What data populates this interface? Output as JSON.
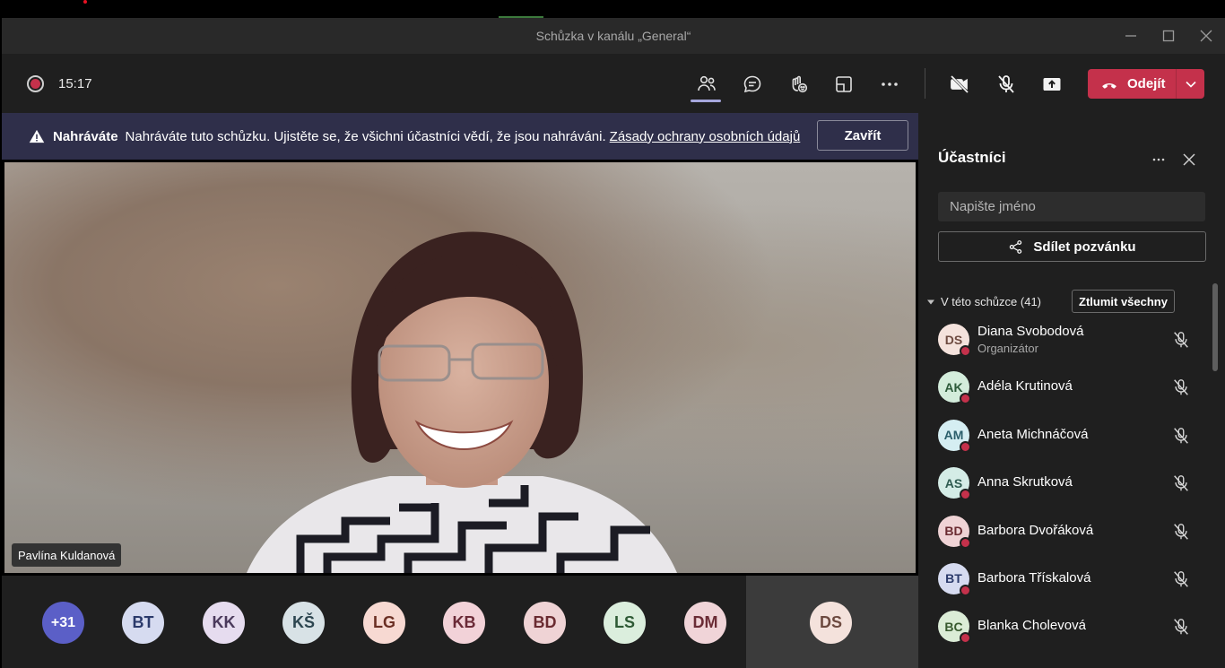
{
  "window": {
    "title": "Schůzka v kanálu „General“",
    "controls": [
      "minimize-icon",
      "maximize-icon",
      "close-icon"
    ]
  },
  "toolbar": {
    "recording_time": "15:17",
    "icons": [
      "participants-icon",
      "chat-icon",
      "reactions-icon",
      "rooms-icon",
      "more-icon",
      "camera-off-icon",
      "mic-off-icon",
      "share-tray-icon"
    ],
    "leave_label": "Odejít",
    "leave_color": "#c4314b",
    "accent_color": "#a6a7dc"
  },
  "banner": {
    "title": "Nahráváte",
    "text": "Nahráváte tuto schůzku. Ujistěte se, že všichni účastníci vědí, že jsou nahráváni.",
    "link": "Zásady ochrany osobních údajů",
    "close_label": "Zavřít"
  },
  "video": {
    "speaker_name": "Pavlína Kuldanová"
  },
  "avatar_strip": [
    {
      "initials": "+31",
      "bg": "#5b5fc7",
      "fg": "#ffffff"
    },
    {
      "initials": "BT",
      "bg": "#d6dbf0",
      "fg": "#2b3a6b"
    },
    {
      "initials": "KK",
      "bg": "#e6dcef",
      "fg": "#4b3a5c"
    },
    {
      "initials": "KŠ",
      "bg": "#d8e2e6",
      "fg": "#2d4650"
    },
    {
      "initials": "LG",
      "bg": "#f7d9d2",
      "fg": "#6b2f24"
    },
    {
      "initials": "KB",
      "bg": "#f2d2d8",
      "fg": "#6b2a37"
    },
    {
      "initials": "BD",
      "bg": "#efd3d5",
      "fg": "#6a2b31"
    },
    {
      "initials": "LS",
      "bg": "#dbeedd",
      "fg": "#2e5a35"
    },
    {
      "initials": "DM",
      "bg": "#f0d4d8",
      "fg": "#6b2c36"
    }
  ],
  "self_tile": {
    "initials": "DS",
    "bg": "#f4e2dc",
    "fg": "#6d4a40"
  },
  "panel": {
    "title": "Účastníci",
    "search_placeholder": "Napište jméno",
    "share_label": "Sdílet pozvánku",
    "section_label": "V této schůzce (41)",
    "mute_all_label": "Ztlumit všechny",
    "participants": [
      {
        "initials": "DS",
        "name": "Diana Svobodová",
        "role": "Organizátor",
        "bg": "#f4e2dc",
        "fg": "#6d4a40"
      },
      {
        "initials": "AK",
        "name": "Adéla Krutinová",
        "role": "",
        "bg": "#d3ecdb",
        "fg": "#2d5a3a"
      },
      {
        "initials": "AM",
        "name": "Aneta Michnáčová",
        "role": "",
        "bg": "#d5eef2",
        "fg": "#2b5f6b"
      },
      {
        "initials": "AS",
        "name": "Anna Skrutková",
        "role": "",
        "bg": "#d4ece6",
        "fg": "#2e5b50"
      },
      {
        "initials": "BD",
        "name": "Barbora Dvořáková",
        "role": "",
        "bg": "#efd3d5",
        "fg": "#6a2b31"
      },
      {
        "initials": "BT",
        "name": "Barbora Třískalová",
        "role": "",
        "bg": "#d6dbf0",
        "fg": "#2b3a6b"
      },
      {
        "initials": "BC",
        "name": "Blanka Cholevová",
        "role": "",
        "bg": "#dbecd6",
        "fg": "#38592e"
      }
    ]
  }
}
